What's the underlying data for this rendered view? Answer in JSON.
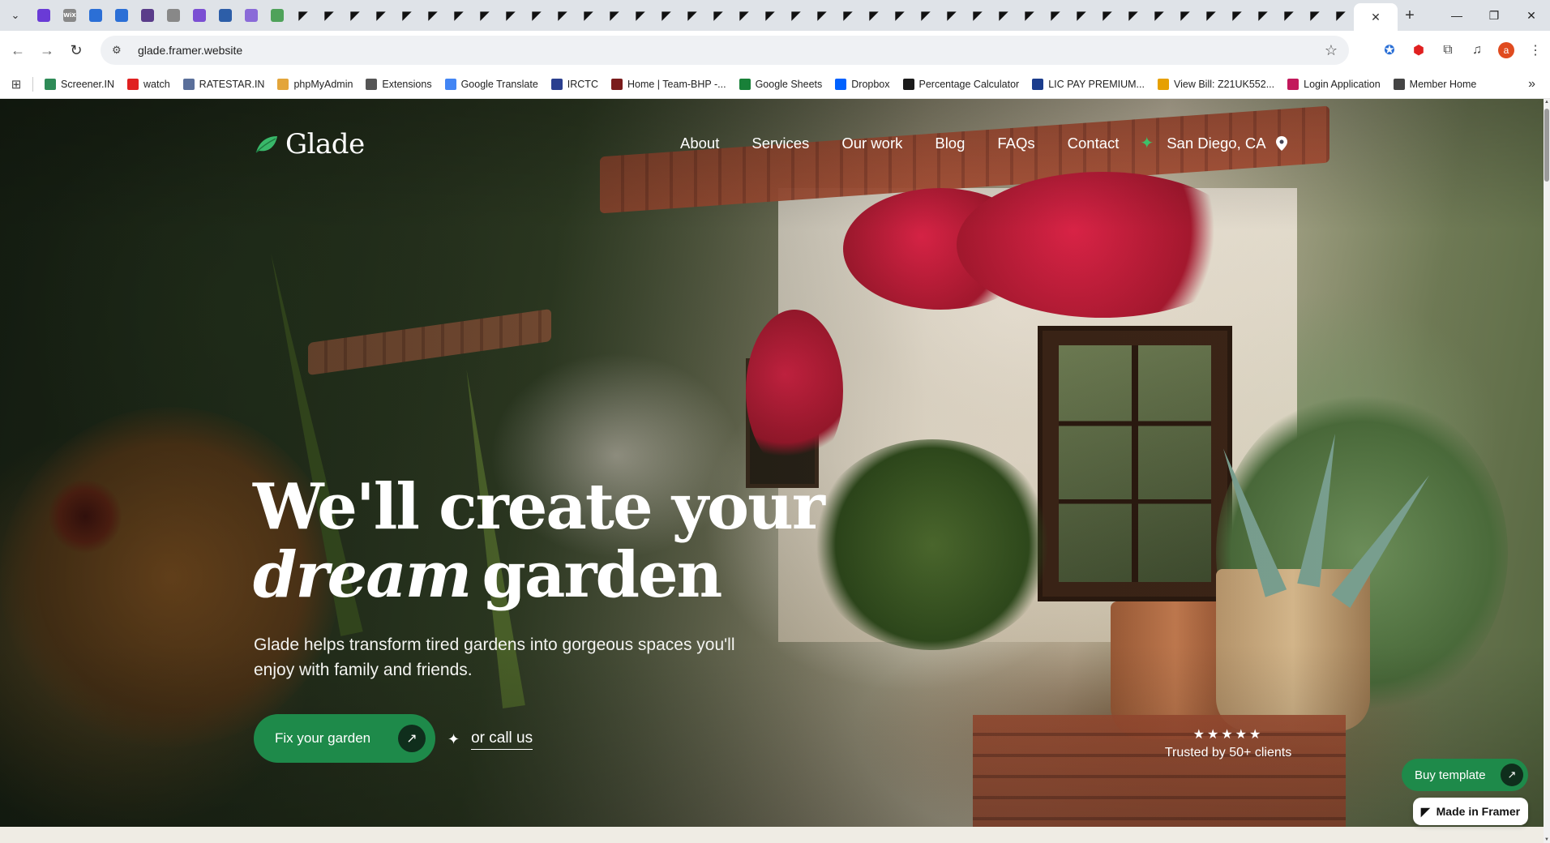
{
  "browser": {
    "tabs": [
      {
        "icon": "chevron-down-icon"
      },
      {
        "icon": "purple-circle-favicon",
        "color": "#6a3bd6"
      },
      {
        "icon": "wix-favicon",
        "text": "WiX"
      },
      {
        "icon": "blue-w-favicon",
        "color": "#2b6fd6"
      },
      {
        "icon": "blue-w-favicon",
        "color": "#2b6fd6"
      },
      {
        "icon": "purple-square-favicon",
        "color": "#5a3c8a"
      },
      {
        "icon": "swirl-favicon"
      },
      {
        "icon": "s-favicon",
        "color": "#7b4fd3"
      },
      {
        "icon": "calendar-favicon",
        "color": "#2d5ea8"
      },
      {
        "icon": "purple-ring-favicon",
        "color": "#8a6ad8"
      },
      {
        "icon": "green-leaf-favicon",
        "color": "#4fa25a"
      }
    ],
    "framer_tab_count": 41,
    "address": "glade.framer.website",
    "bookmarks": [
      {
        "label": "Screener.IN",
        "color": "#2e8b57"
      },
      {
        "label": "watch",
        "color": "#e02020"
      },
      {
        "label": "RATESTAR.IN",
        "color": "#5a6f9a"
      },
      {
        "label": "phpMyAdmin",
        "color": "#e3a53a"
      },
      {
        "label": "Extensions",
        "color": "#555555"
      },
      {
        "label": "Google Translate",
        "color": "#4285f4"
      },
      {
        "label": "IRCTC",
        "color": "#2a3f8f"
      },
      {
        "label": "Home | Team-BHP -...",
        "color": "#7a1b1b"
      },
      {
        "label": "Google Sheets",
        "color": "#188038"
      },
      {
        "label": "Dropbox",
        "color": "#0061fe"
      },
      {
        "label": "Percentage Calculator",
        "color": "#1a1a1a"
      },
      {
        "label": "LIC PAY PREMIUM...",
        "color": "#1b3c8c"
      },
      {
        "label": "View Bill: Z21UK552...",
        "color": "#e6a000"
      },
      {
        "label": "Login Application",
        "color": "#c2185b"
      },
      {
        "label": "Member Home",
        "color": "#444444"
      }
    ],
    "avatar_letter": "a"
  },
  "site": {
    "brand": "Glade",
    "nav": [
      "About",
      "Services",
      "Our work",
      "Blog",
      "FAQs",
      "Contact"
    ],
    "location": "San Diego, CA",
    "heading_line1": "We'll create your",
    "heading_em": "dream",
    "heading_line2_rest": "garden",
    "subtitle": "Glade helps transform tired gardens into gorgeous spaces you'll enjoy with family and friends.",
    "cta_label": "Fix your garden",
    "call_label": "or call us",
    "rating_stars": 5,
    "stars_text": "★★★★★",
    "trust_text": "Trusted by 50+ clients",
    "buy_label": "Buy template",
    "made_label": "Made in Framer",
    "accent_color": "#1e8a4a",
    "accent_dark": "#0f2e1c"
  }
}
